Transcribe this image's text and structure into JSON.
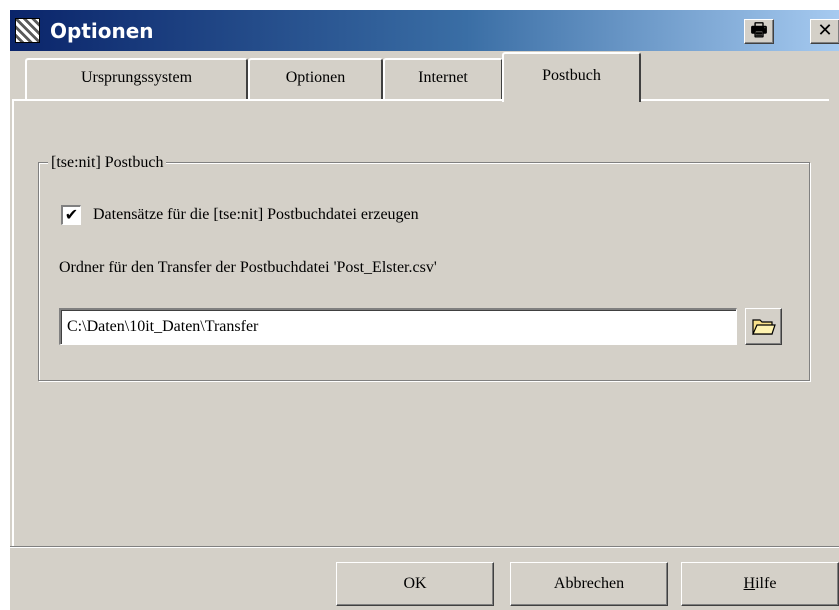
{
  "window": {
    "title": "Optionen",
    "print_glyph": "🖶",
    "close_glyph": "✕"
  },
  "tabs": [
    {
      "label": "Ursprungssystem",
      "active": false
    },
    {
      "label": "Optionen",
      "active": false
    },
    {
      "label": "Internet",
      "active": false
    },
    {
      "label": "Postbuch",
      "active": true
    }
  ],
  "group": {
    "label": "[tse:nit] Postbuch",
    "checkbox": {
      "checked": true,
      "check_glyph": "✔",
      "label": "Datensätze für die [tse:nit] Postbuchdatei erzeugen"
    },
    "folder_label": "Ordner für den Transfer der Postbuchdatei 'Post_Elster.csv'",
    "folder_path": "C:\\Daten\\10it_Daten\\Transfer",
    "browse_icon": "folder-icon"
  },
  "buttons": {
    "ok": "OK",
    "cancel": "Abbrechen",
    "help_accel": "H",
    "help_rest": "ilfe"
  }
}
